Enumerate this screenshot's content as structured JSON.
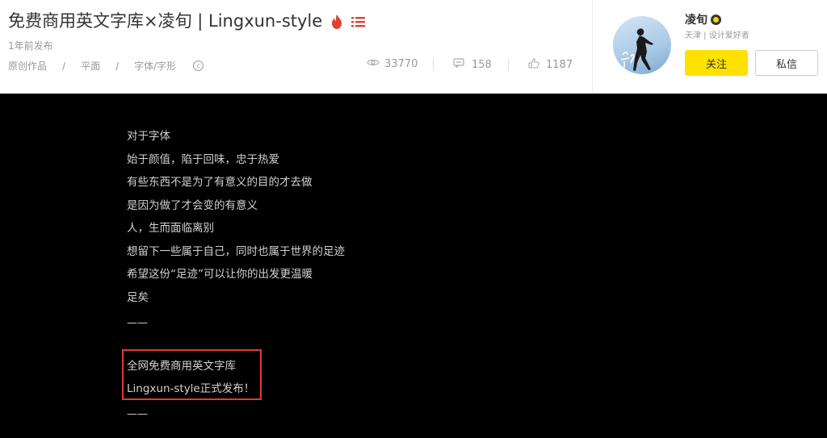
{
  "header": {
    "title": "免费商用英文字库×凌旬 | Lingxun-style",
    "published": "1年前发布",
    "categories": [
      "原创作品",
      "平面",
      "字体/字形"
    ],
    "separator": "/",
    "cc_symbol": "c",
    "stats": {
      "views": "33770",
      "comments": "158",
      "likes": "1187"
    },
    "icons": [
      "fire-icon",
      "list-icon",
      "creative-commons-icon",
      "eye-icon",
      "comment-icon",
      "thumbs-up-icon"
    ],
    "accent": "#e1412f"
  },
  "author": {
    "name": "凌旬",
    "desc": "天津 | 设计爱好者",
    "follow_label": "关注",
    "message_label": "私信",
    "follow_color": "#ffe100"
  },
  "content": {
    "lines": [
      "对于字体",
      "始于颜值，陷于回味，忠于热爱",
      "有些东西不是为了有意义的目的才去做",
      "是因为做了才会变的有意义",
      "人，生而面临离别",
      "想留下一些属于自己，同时也属于世界的足迹",
      "希望这份“足迹”可以让你的出发更温暖",
      "足矣"
    ],
    "dash": "——",
    "highlight": [
      "全网免费商用英文字库",
      "Lingxun-style正式发布！"
    ],
    "dash2": "——",
    "highlight_border": "#e03a3a"
  }
}
